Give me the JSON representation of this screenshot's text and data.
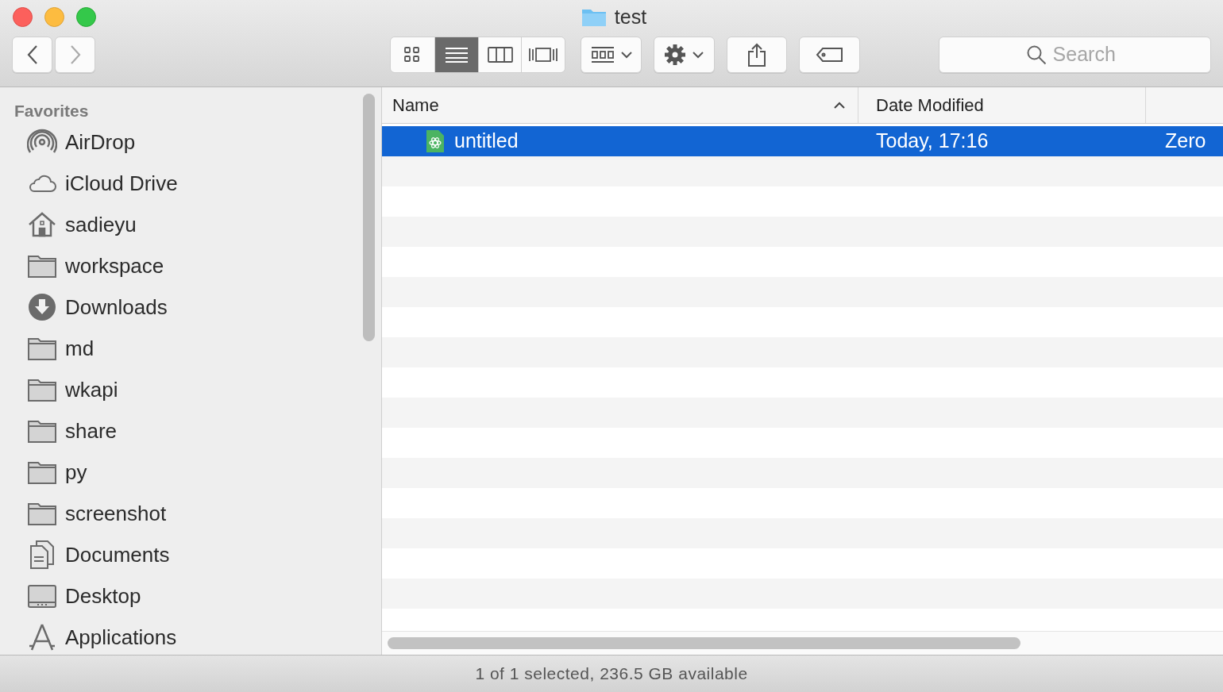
{
  "window": {
    "title": "test"
  },
  "toolbar": {
    "view_modes": [
      {
        "kind": "icons",
        "selected": false
      },
      {
        "kind": "list",
        "selected": true
      },
      {
        "kind": "columns",
        "selected": false
      },
      {
        "kind": "coverflow",
        "selected": false
      }
    ],
    "search": {
      "placeholder": "Search"
    }
  },
  "sidebar": {
    "section": "Favorites",
    "items": [
      {
        "label": "AirDrop",
        "kind": "airdrop"
      },
      {
        "label": "iCloud Drive",
        "kind": "cloud"
      },
      {
        "label": "sadieyu",
        "kind": "home"
      },
      {
        "label": "workspace",
        "kind": "folder"
      },
      {
        "label": "Downloads",
        "kind": "download"
      },
      {
        "label": "md",
        "kind": "folder"
      },
      {
        "label": "wkapi",
        "kind": "folder"
      },
      {
        "label": "share",
        "kind": "folder"
      },
      {
        "label": "py",
        "kind": "folder"
      },
      {
        "label": "screenshot",
        "kind": "folder"
      },
      {
        "label": "Documents",
        "kind": "documents"
      },
      {
        "label": "Desktop",
        "kind": "desktop"
      },
      {
        "label": "Applications",
        "kind": "applications"
      }
    ]
  },
  "table": {
    "columns": [
      "Name",
      "Date Modified"
    ],
    "rows": [
      {
        "name": "untitled",
        "date": "Today, 17:16",
        "column_3": "Zero",
        "selected": true
      }
    ]
  },
  "status_bar": "1 of 1 selected, 236.5 GB available"
}
